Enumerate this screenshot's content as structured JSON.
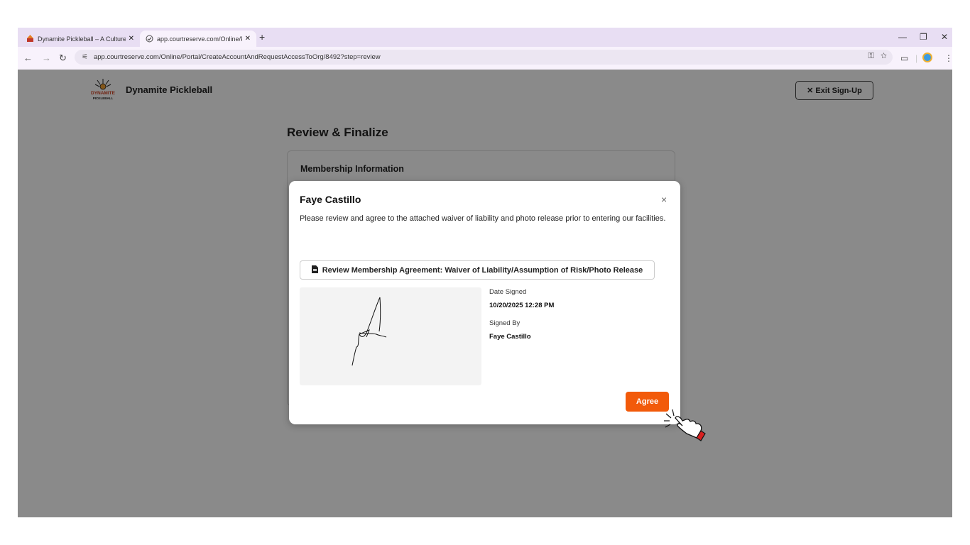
{
  "browser": {
    "tabs": [
      {
        "title": "Dynamite Pickleball – A Culture",
        "active": false
      },
      {
        "title": "app.courtreserve.com/Online/P",
        "active": true
      }
    ],
    "new_tab_label": "+",
    "url": "app.courtreserve.com/Online/Portal/CreateAccountAndRequestAccessToOrg/8492?step=review"
  },
  "header": {
    "brand_name": "Dynamite Pickleball",
    "exit_button": "✕ Exit Sign-Up"
  },
  "main": {
    "heading": "Review & Finalize",
    "card_title": "Membership Information"
  },
  "modal": {
    "title": "Faye Castillo",
    "close_label": "×",
    "message": "Please review and agree to the attached waiver of liability and photo release prior to entering our facilities.",
    "review_button": "Review Membership Agreement: Waiver of Liability/Assumption of Risk/Photo Release",
    "date_signed_label": "Date Signed",
    "date_signed_value": "10/20/2025 12:28 PM",
    "signed_by_label": "Signed By",
    "signed_by_value": "Faye Castillo",
    "agree_button": "Agree"
  },
  "colors": {
    "accent": "#f25a0a",
    "tab_strip": "#e8def3",
    "overlay": "rgba(0,0,0,0.46)"
  },
  "icons": [
    "favicon-icon",
    "check-favicon-icon",
    "back-icon",
    "forward-icon",
    "reload-icon",
    "site-settings-icon",
    "password-key-icon",
    "star-icon",
    "reading-mode-icon",
    "profile-avatar-icon",
    "more-icon",
    "minimize-icon",
    "maximize-icon",
    "close-window-icon",
    "document-icon",
    "pointer-hand-icon"
  ]
}
